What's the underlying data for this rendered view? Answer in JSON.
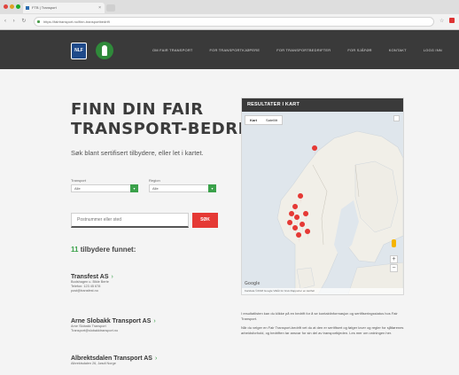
{
  "browser": {
    "tab_title": "FTB | Transport",
    "tab_close": "×",
    "nav_buttons": "‹ › ↻",
    "url": "https://fairtransport.no/finn-transportbedrift"
  },
  "site": {
    "logo_nlf": "NLF",
    "nav": [
      "OM FAIR TRANSPORT",
      "FOR TRANSPORTKJØPERE",
      "FOR TRANSPORTBEDRIFTER",
      "FOR SJÅFØR",
      "KONTAKT",
      "LOGG INN"
    ]
  },
  "hero": {
    "title_line1": "FINN DIN FAIR",
    "title_line2": "TRANSPORT-BEDRIFT",
    "subtitle": "Søk blant sertifisert tilbydere, eller let i kartet."
  },
  "filters": {
    "type_label": "Transport",
    "type_value": "Alle",
    "region_label": "Region",
    "region_value": "Alle",
    "search_placeholder": "Postnummer eller sted",
    "search_button": "SØK"
  },
  "results": {
    "count": "11",
    "count_suffix": "tilbydere funnet:",
    "companies": [
      {
        "name": "Transfest AS",
        "lines": [
          "Bodshagen u. Bikle Berte",
          "Telefon: 123 45 678",
          "post@transfest.no"
        ]
      },
      {
        "name": "Arne Slobakk Transport AS",
        "lines": [
          "Arne Slobakk Transport",
          "Transport@slobakktransport.no"
        ]
      },
      {
        "name": "Albrektsdalen Transport AS",
        "lines": [
          "Albrektsdalen 26, Jøsdi Norge"
        ]
      }
    ]
  },
  "map": {
    "header": "RESULTATER I KART",
    "tab_map": "Kart",
    "tab_satellite": "Satellitt",
    "zoom_in": "+",
    "zoom_out": "−",
    "google": "Google",
    "footer": "Kartdata ©2018 Google  Vilkår for bruk  Rapporter en kartfeil",
    "caption_1": "I resultatlisten kan du klikke på en bedrift for å se kontaktinformasjon og sertifiseringsstatus hos Fair Transport.",
    "caption_2": "Når du velger en Fair Transport-bedrift vet du at den er sertifisert og følger lover og regler for sjåførenes arbeidsforhold, og bedriften tar ansvar for sin del av transportkjeden. Les mer om ordningen her."
  }
}
